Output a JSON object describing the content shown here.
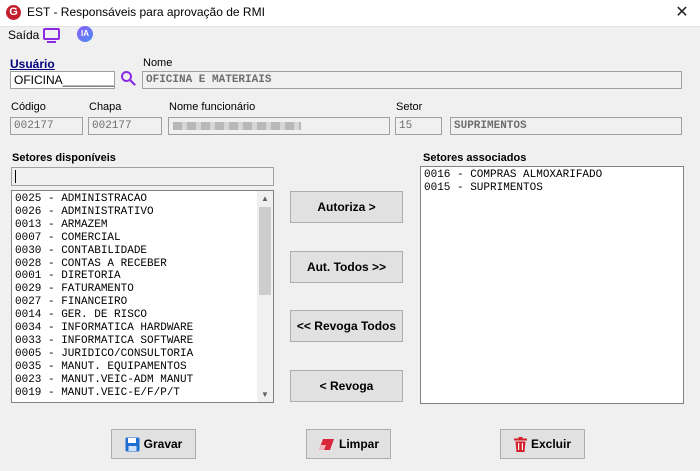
{
  "window": {
    "title": "EST - Responsáveis para aprovação de RMI",
    "close_glyph": "✕"
  },
  "menu": {
    "saida": "Saída",
    "monitor_icon": "monitor-icon",
    "ia_label": "IA"
  },
  "usuario": {
    "label": "Usuário",
    "value": "OFICINA________"
  },
  "nome": {
    "label": "Nome",
    "value": "OFICINA E MATERIAIS"
  },
  "codigo": {
    "label": "Código",
    "value": "002177"
  },
  "chapa": {
    "label": "Chapa",
    "value": "002177"
  },
  "nome_funcionario": {
    "label": "Nome funcionário",
    "value": ""
  },
  "setor": {
    "label": "Setor",
    "code": "15",
    "name": "SUPRIMENTOS"
  },
  "disponiveis": {
    "label": "Setores disponíveis",
    "filter": "",
    "items": [
      "0025 - ADMINISTRACAO",
      "0026 - ADMINISTRATIVO",
      "0013 - ARMAZEM",
      "0007 - COMERCIAL",
      "0030 - CONTABILIDADE",
      "0028 - CONTAS A RECEBER",
      "0001 - DIRETORIA",
      "0029 - FATURAMENTO",
      "0027 - FINANCEIRO",
      "0014 - GER. DE RISCO",
      "0034 - INFORMATICA HARDWARE",
      "0033 - INFORMATICA SOFTWARE",
      "0005 - JURIDICO/CONSULTORIA",
      "0035 - MANUT. EQUIPAMENTOS",
      "0023 - MANUT.VEIC-ADM MANUT",
      "0019 - MANUT.VEIC-E/F/P/T"
    ]
  },
  "associados": {
    "label": "Setores associados",
    "items": [
      "0016 - COMPRAS ALMOXARIFADO",
      "0015 - SUPRIMENTOS"
    ]
  },
  "actions": {
    "autoriza": "Autoriza >",
    "aut_todos": "Aut. Todos >>",
    "revoga_todos": "<< Revoga Todos",
    "revoga": "< Revoga"
  },
  "footer": {
    "gravar": "Gravar",
    "limpar": "Limpar",
    "excluir": "Excluir"
  }
}
